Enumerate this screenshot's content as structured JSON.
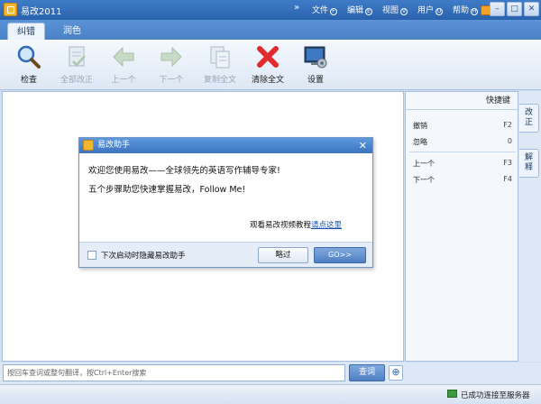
{
  "window": {
    "title": "易改2011",
    "menus": [
      {
        "label": "文件",
        "key": "F"
      },
      {
        "label": "编辑",
        "key": "E"
      },
      {
        "label": "视图",
        "key": "V"
      },
      {
        "label": "用户",
        "key": "U"
      },
      {
        "label": "帮助",
        "key": "H"
      }
    ]
  },
  "tabs": [
    "纠错",
    "润色"
  ],
  "toolbar": {
    "check": "检查",
    "fix_all": "全部改正",
    "prev": "上一个",
    "next": "下一个",
    "copy_all": "复制全文",
    "clear_all": "清除全文",
    "settings": "设置"
  },
  "right_panel": {
    "header": "快捷键",
    "shortcuts": [
      {
        "label": "撤销",
        "key": "F2"
      },
      {
        "label": "忽略",
        "key": "0"
      },
      {
        "label": "上一个",
        "key": "F3"
      },
      {
        "label": "下一个",
        "key": "F4"
      }
    ],
    "side_tabs": [
      "改正",
      "解释"
    ]
  },
  "dialog": {
    "title": "易改助手",
    "line1": "欢迎您使用易改——全球领先的英语写作辅导专家!",
    "line2": "五个步骤助您快速掌握易改，Follow Me!",
    "video_text": "观看易改视频教程",
    "video_link": "请点这里",
    "checkbox_label": "下次启动时隐藏易改助手",
    "skip_button": "略过",
    "go_button": "GO>>"
  },
  "search": {
    "placeholder": "按回车查词或整句翻译，按Ctrl+Enter搜索",
    "button": "查词"
  },
  "status": {
    "text": "已成功连接至服务器"
  },
  "icons": {
    "check": "magnifier-icon",
    "fix_all": "document-check-icon",
    "prev": "arrow-left-icon",
    "next": "arrow-right-icon",
    "copy_all": "copy-icon",
    "clear_all": "red-x-icon",
    "settings": "monitor-gear-icon"
  },
  "colors": {
    "title_bar": "#2f6bb8",
    "accent": "#4f7fc4",
    "clear_red": "#e02c2c",
    "status_green": "#3c9a3c"
  }
}
